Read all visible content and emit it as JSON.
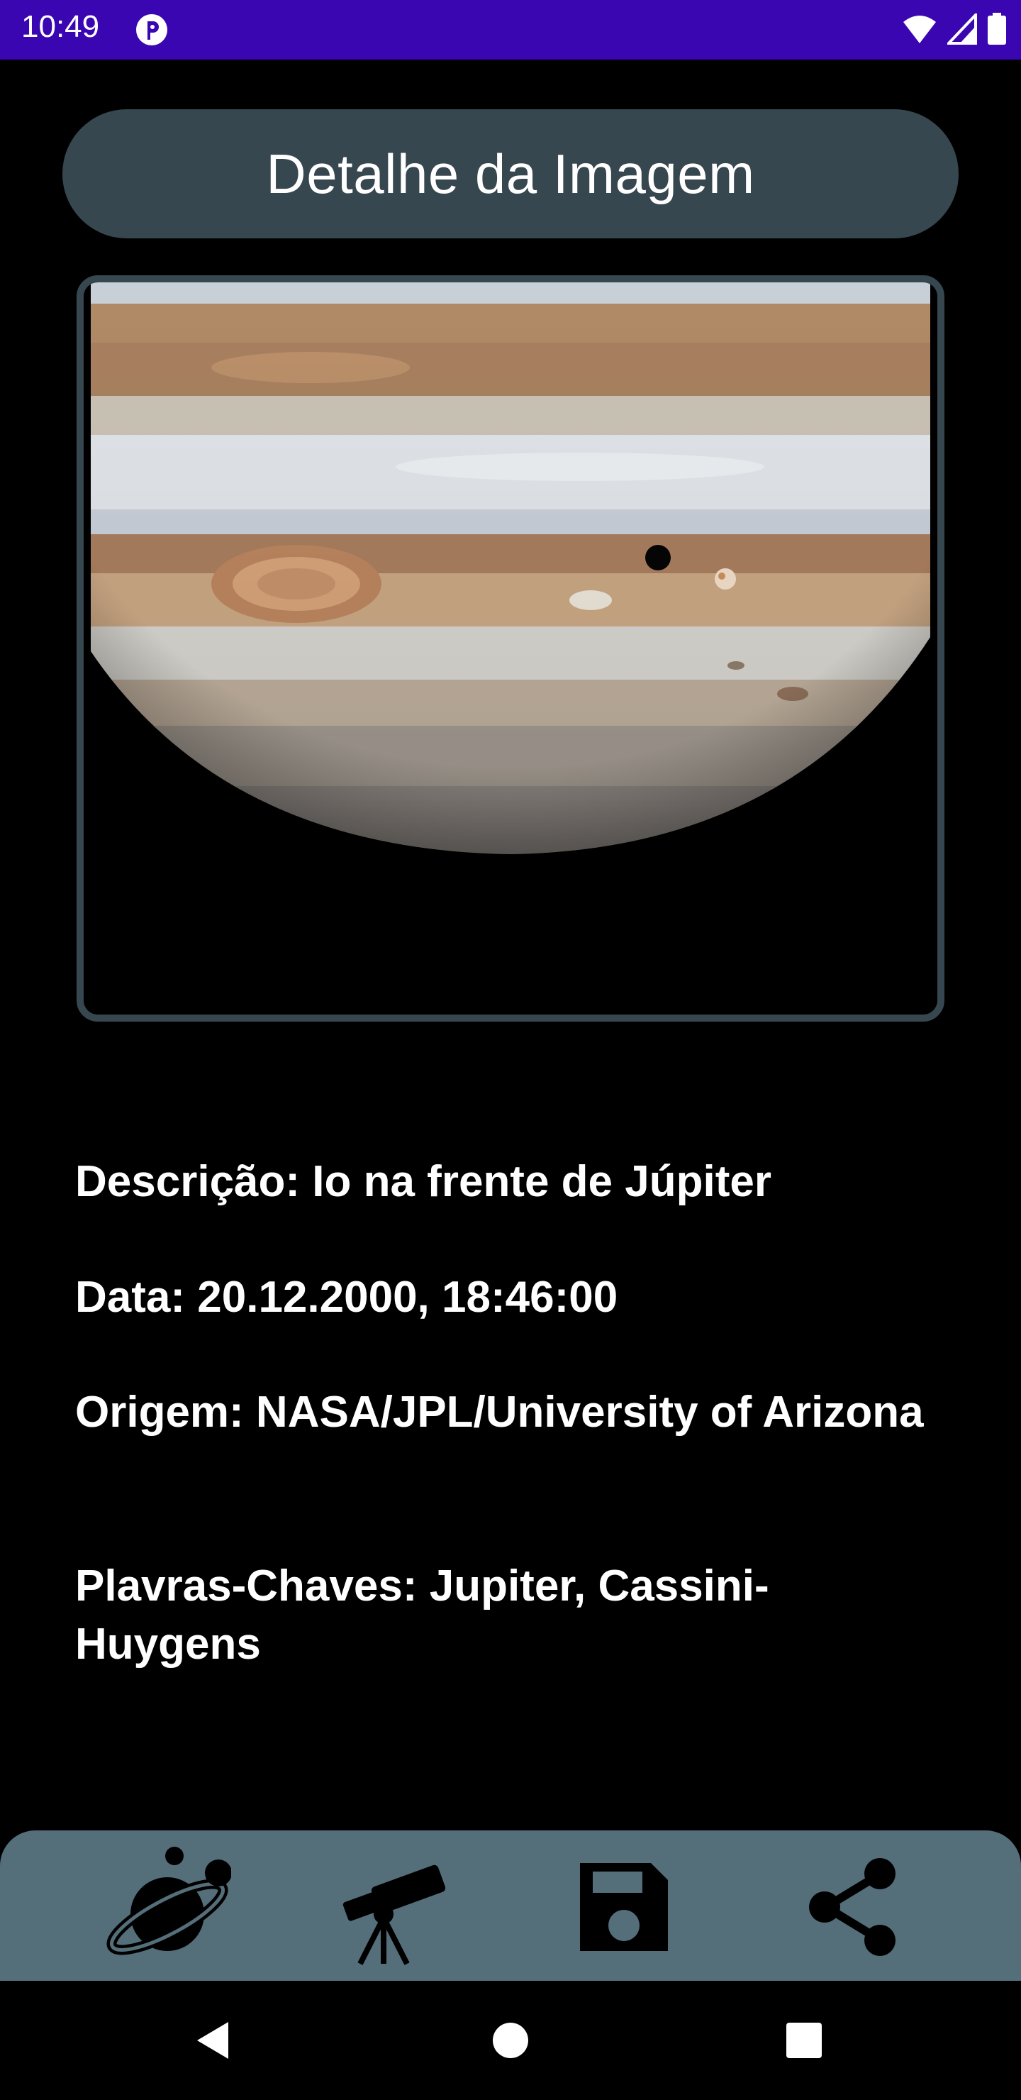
{
  "status_bar": {
    "time": "10:49",
    "icons": [
      "app-notification-icon",
      "wifi-icon",
      "cellular-signal-icon",
      "battery-icon"
    ],
    "color": "#3a06b1"
  },
  "header": {
    "title": "Detalhe da Imagem"
  },
  "image": {
    "subject": "Jupiter-with-Io-and-shadow"
  },
  "details": {
    "description": "Descrição: Io na frente de Júpiter",
    "date": "Data: 20.12.2000,  18:46:00",
    "origin": "Origem: NASA/JPL/University of Arizona",
    "keywords": "Plavras-Chaves: Jupiter, Cassini-Huygens"
  },
  "bottom_nav": {
    "items": [
      "planet-icon",
      "telescope-icon",
      "save-icon",
      "share-icon"
    ],
    "background": "#546e7a"
  },
  "system_nav": {
    "items": [
      "back-icon",
      "home-icon",
      "recent-apps-icon"
    ]
  },
  "colors": {
    "accent": "#37474f",
    "background": "#000000",
    "text": "#ffffff"
  }
}
